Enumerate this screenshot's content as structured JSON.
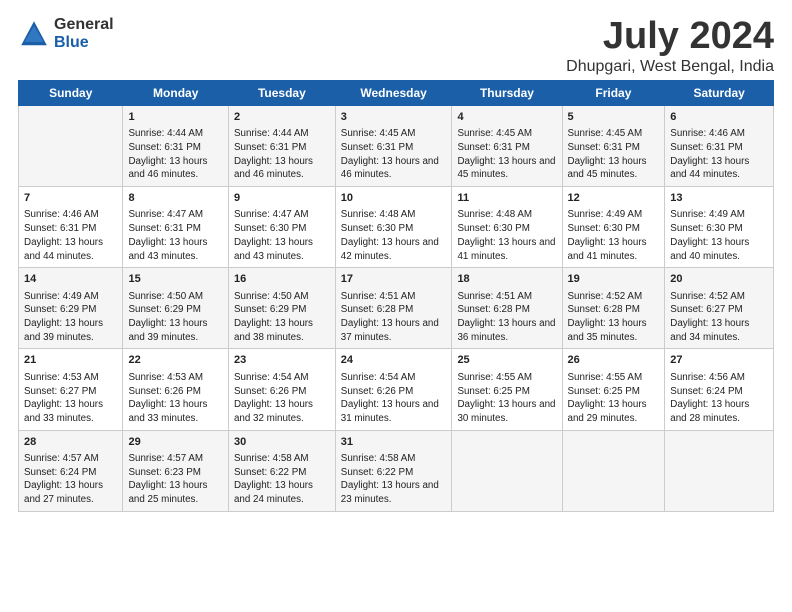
{
  "logo": {
    "general": "General",
    "blue": "Blue"
  },
  "title": "July 2024",
  "subtitle": "Dhupgari, West Bengal, India",
  "days": [
    "Sunday",
    "Monday",
    "Tuesday",
    "Wednesday",
    "Thursday",
    "Friday",
    "Saturday"
  ],
  "weeks": [
    [
      {
        "date": "",
        "sunrise": "",
        "sunset": "",
        "daylight": ""
      },
      {
        "date": "1",
        "sunrise": "Sunrise: 4:44 AM",
        "sunset": "Sunset: 6:31 PM",
        "daylight": "Daylight: 13 hours and 46 minutes."
      },
      {
        "date": "2",
        "sunrise": "Sunrise: 4:44 AM",
        "sunset": "Sunset: 6:31 PM",
        "daylight": "Daylight: 13 hours and 46 minutes."
      },
      {
        "date": "3",
        "sunrise": "Sunrise: 4:45 AM",
        "sunset": "Sunset: 6:31 PM",
        "daylight": "Daylight: 13 hours and 46 minutes."
      },
      {
        "date": "4",
        "sunrise": "Sunrise: 4:45 AM",
        "sunset": "Sunset: 6:31 PM",
        "daylight": "Daylight: 13 hours and 45 minutes."
      },
      {
        "date": "5",
        "sunrise": "Sunrise: 4:45 AM",
        "sunset": "Sunset: 6:31 PM",
        "daylight": "Daylight: 13 hours and 45 minutes."
      },
      {
        "date": "6",
        "sunrise": "Sunrise: 4:46 AM",
        "sunset": "Sunset: 6:31 PM",
        "daylight": "Daylight: 13 hours and 44 minutes."
      }
    ],
    [
      {
        "date": "7",
        "sunrise": "Sunrise: 4:46 AM",
        "sunset": "Sunset: 6:31 PM",
        "daylight": "Daylight: 13 hours and 44 minutes."
      },
      {
        "date": "8",
        "sunrise": "Sunrise: 4:47 AM",
        "sunset": "Sunset: 6:31 PM",
        "daylight": "Daylight: 13 hours and 43 minutes."
      },
      {
        "date": "9",
        "sunrise": "Sunrise: 4:47 AM",
        "sunset": "Sunset: 6:30 PM",
        "daylight": "Daylight: 13 hours and 43 minutes."
      },
      {
        "date": "10",
        "sunrise": "Sunrise: 4:48 AM",
        "sunset": "Sunset: 6:30 PM",
        "daylight": "Daylight: 13 hours and 42 minutes."
      },
      {
        "date": "11",
        "sunrise": "Sunrise: 4:48 AM",
        "sunset": "Sunset: 6:30 PM",
        "daylight": "Daylight: 13 hours and 41 minutes."
      },
      {
        "date": "12",
        "sunrise": "Sunrise: 4:49 AM",
        "sunset": "Sunset: 6:30 PM",
        "daylight": "Daylight: 13 hours and 41 minutes."
      },
      {
        "date": "13",
        "sunrise": "Sunrise: 4:49 AM",
        "sunset": "Sunset: 6:30 PM",
        "daylight": "Daylight: 13 hours and 40 minutes."
      }
    ],
    [
      {
        "date": "14",
        "sunrise": "Sunrise: 4:49 AM",
        "sunset": "Sunset: 6:29 PM",
        "daylight": "Daylight: 13 hours and 39 minutes."
      },
      {
        "date": "15",
        "sunrise": "Sunrise: 4:50 AM",
        "sunset": "Sunset: 6:29 PM",
        "daylight": "Daylight: 13 hours and 39 minutes."
      },
      {
        "date": "16",
        "sunrise": "Sunrise: 4:50 AM",
        "sunset": "Sunset: 6:29 PM",
        "daylight": "Daylight: 13 hours and 38 minutes."
      },
      {
        "date": "17",
        "sunrise": "Sunrise: 4:51 AM",
        "sunset": "Sunset: 6:28 PM",
        "daylight": "Daylight: 13 hours and 37 minutes."
      },
      {
        "date": "18",
        "sunrise": "Sunrise: 4:51 AM",
        "sunset": "Sunset: 6:28 PM",
        "daylight": "Daylight: 13 hours and 36 minutes."
      },
      {
        "date": "19",
        "sunrise": "Sunrise: 4:52 AM",
        "sunset": "Sunset: 6:28 PM",
        "daylight": "Daylight: 13 hours and 35 minutes."
      },
      {
        "date": "20",
        "sunrise": "Sunrise: 4:52 AM",
        "sunset": "Sunset: 6:27 PM",
        "daylight": "Daylight: 13 hours and 34 minutes."
      }
    ],
    [
      {
        "date": "21",
        "sunrise": "Sunrise: 4:53 AM",
        "sunset": "Sunset: 6:27 PM",
        "daylight": "Daylight: 13 hours and 33 minutes."
      },
      {
        "date": "22",
        "sunrise": "Sunrise: 4:53 AM",
        "sunset": "Sunset: 6:26 PM",
        "daylight": "Daylight: 13 hours and 33 minutes."
      },
      {
        "date": "23",
        "sunrise": "Sunrise: 4:54 AM",
        "sunset": "Sunset: 6:26 PM",
        "daylight": "Daylight: 13 hours and 32 minutes."
      },
      {
        "date": "24",
        "sunrise": "Sunrise: 4:54 AM",
        "sunset": "Sunset: 6:26 PM",
        "daylight": "Daylight: 13 hours and 31 minutes."
      },
      {
        "date": "25",
        "sunrise": "Sunrise: 4:55 AM",
        "sunset": "Sunset: 6:25 PM",
        "daylight": "Daylight: 13 hours and 30 minutes."
      },
      {
        "date": "26",
        "sunrise": "Sunrise: 4:55 AM",
        "sunset": "Sunset: 6:25 PM",
        "daylight": "Daylight: 13 hours and 29 minutes."
      },
      {
        "date": "27",
        "sunrise": "Sunrise: 4:56 AM",
        "sunset": "Sunset: 6:24 PM",
        "daylight": "Daylight: 13 hours and 28 minutes."
      }
    ],
    [
      {
        "date": "28",
        "sunrise": "Sunrise: 4:57 AM",
        "sunset": "Sunset: 6:24 PM",
        "daylight": "Daylight: 13 hours and 27 minutes."
      },
      {
        "date": "29",
        "sunrise": "Sunrise: 4:57 AM",
        "sunset": "Sunset: 6:23 PM",
        "daylight": "Daylight: 13 hours and 25 minutes."
      },
      {
        "date": "30",
        "sunrise": "Sunrise: 4:58 AM",
        "sunset": "Sunset: 6:22 PM",
        "daylight": "Daylight: 13 hours and 24 minutes."
      },
      {
        "date": "31",
        "sunrise": "Sunrise: 4:58 AM",
        "sunset": "Sunset: 6:22 PM",
        "daylight": "Daylight: 13 hours and 23 minutes."
      },
      {
        "date": "",
        "sunrise": "",
        "sunset": "",
        "daylight": ""
      },
      {
        "date": "",
        "sunrise": "",
        "sunset": "",
        "daylight": ""
      },
      {
        "date": "",
        "sunrise": "",
        "sunset": "",
        "daylight": ""
      }
    ]
  ]
}
